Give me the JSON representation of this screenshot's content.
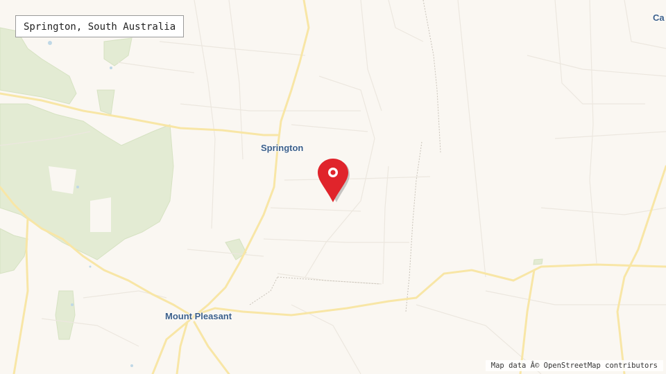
{
  "map": {
    "title": "Springton, South Australia",
    "attribution": "Map data Â© OpenStreetMap contributors",
    "places": {
      "springton": "Springton",
      "mount_pleasant": "Mount Pleasant",
      "edge_label": "Ca"
    },
    "marker": {
      "icon": "map-pin-icon",
      "color": "#e0242b"
    },
    "colors": {
      "land": "#faf7f2",
      "vegetation": "#e4ecd4",
      "main_road": "#fbe9a8",
      "minor_road": "#ebe6de",
      "label": "#3b5f8a"
    }
  }
}
